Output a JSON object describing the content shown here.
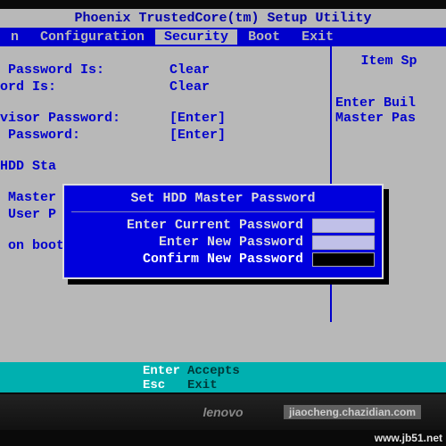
{
  "title": "Phoenix TrustedCore(tm) Setup Utility",
  "tabs": {
    "t0": "n",
    "t1": "Configuration",
    "t2": "Security",
    "t3": "Boot",
    "t4": "Exit"
  },
  "left": {
    "row1_lbl": " Password Is:",
    "row1_val": "Clear",
    "row2_lbl": "ord Is:",
    "row2_val": "Clear",
    "row3_lbl": "visor Password:",
    "row3_val": "[Enter]",
    "row4_lbl": " Password:",
    "row4_val": "[Enter]",
    "row5_lbl": "HDD Sta",
    "row6_lbl": " Master",
    "row7_lbl": " User P",
    "row8_lbl": " on boot"
  },
  "right": {
    "heading": "Item Sp",
    "help1": "Enter Buil",
    "help2": "Master Pas"
  },
  "dialog": {
    "title": "Set HDD Master Password",
    "r1": "Enter Current Password",
    "r2": "Enter New Password",
    "r3": "Confirm New Password"
  },
  "keys": {
    "k1": "Enter",
    "v1": "Accepts",
    "k2": "Esc",
    "v2": "Exit"
  },
  "brand": "lenovo",
  "watermark_main": "www.jb51.net",
  "watermark_sub": "jiaocheng.chazidian.com"
}
